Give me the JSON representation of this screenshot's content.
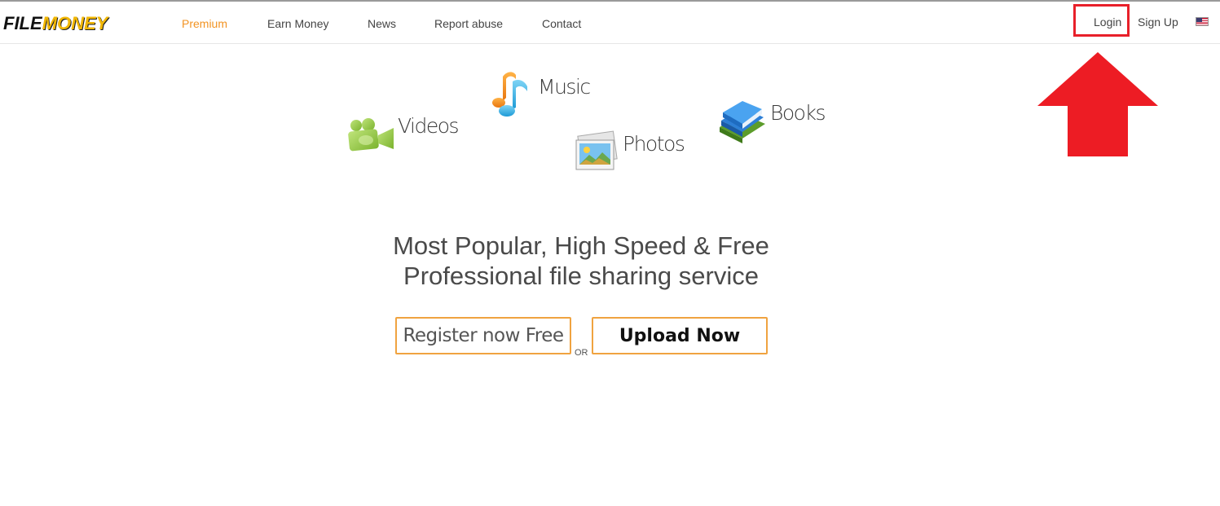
{
  "brand": {
    "part1": "FILE",
    "part2": "MONEY"
  },
  "nav": {
    "items": [
      {
        "label": "Premium",
        "active": true
      },
      {
        "label": "Earn Money"
      },
      {
        "label": "News"
      },
      {
        "label": "Report abuse"
      },
      {
        "label": "Contact"
      }
    ]
  },
  "account": {
    "login": "Login",
    "signup": "Sign Up",
    "language_flag": "us-flag-icon"
  },
  "annotation": {
    "highlight_color": "#e8202a",
    "arrow_color": "#ed1c24"
  },
  "categories": {
    "music": "Music",
    "videos": "Videos",
    "photos": "Photos",
    "books": "Books"
  },
  "hero": {
    "line1": "Most Popular, High Speed & Free",
    "line2": "Professional file sharing service"
  },
  "cta": {
    "register": "Register now Free",
    "or": "OR",
    "upload": "Upload Now",
    "border_color": "#f0a340"
  },
  "colors": {
    "accent": "#f29322"
  }
}
